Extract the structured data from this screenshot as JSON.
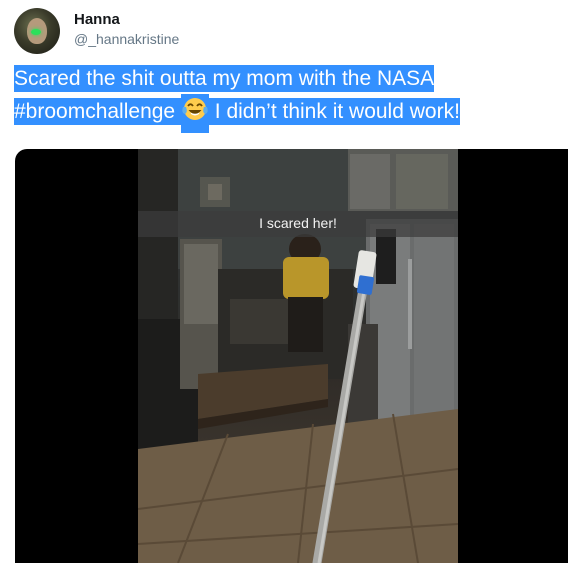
{
  "user": {
    "display_name": "Hanna",
    "handle": "@_hannakristine"
  },
  "tweet": {
    "line1": "Scared the shit outta my mom with the NASA",
    "hashtag": "#broomchallenge",
    "emoji_name": "face-with-tears-of-joy-emoji",
    "line2_rest": "I didn’t think it would work!"
  },
  "media": {
    "caption": "I scared her!"
  },
  "colors": {
    "selection_highlight": "#3390ff",
    "name": "#14171a",
    "handle": "#657786"
  }
}
